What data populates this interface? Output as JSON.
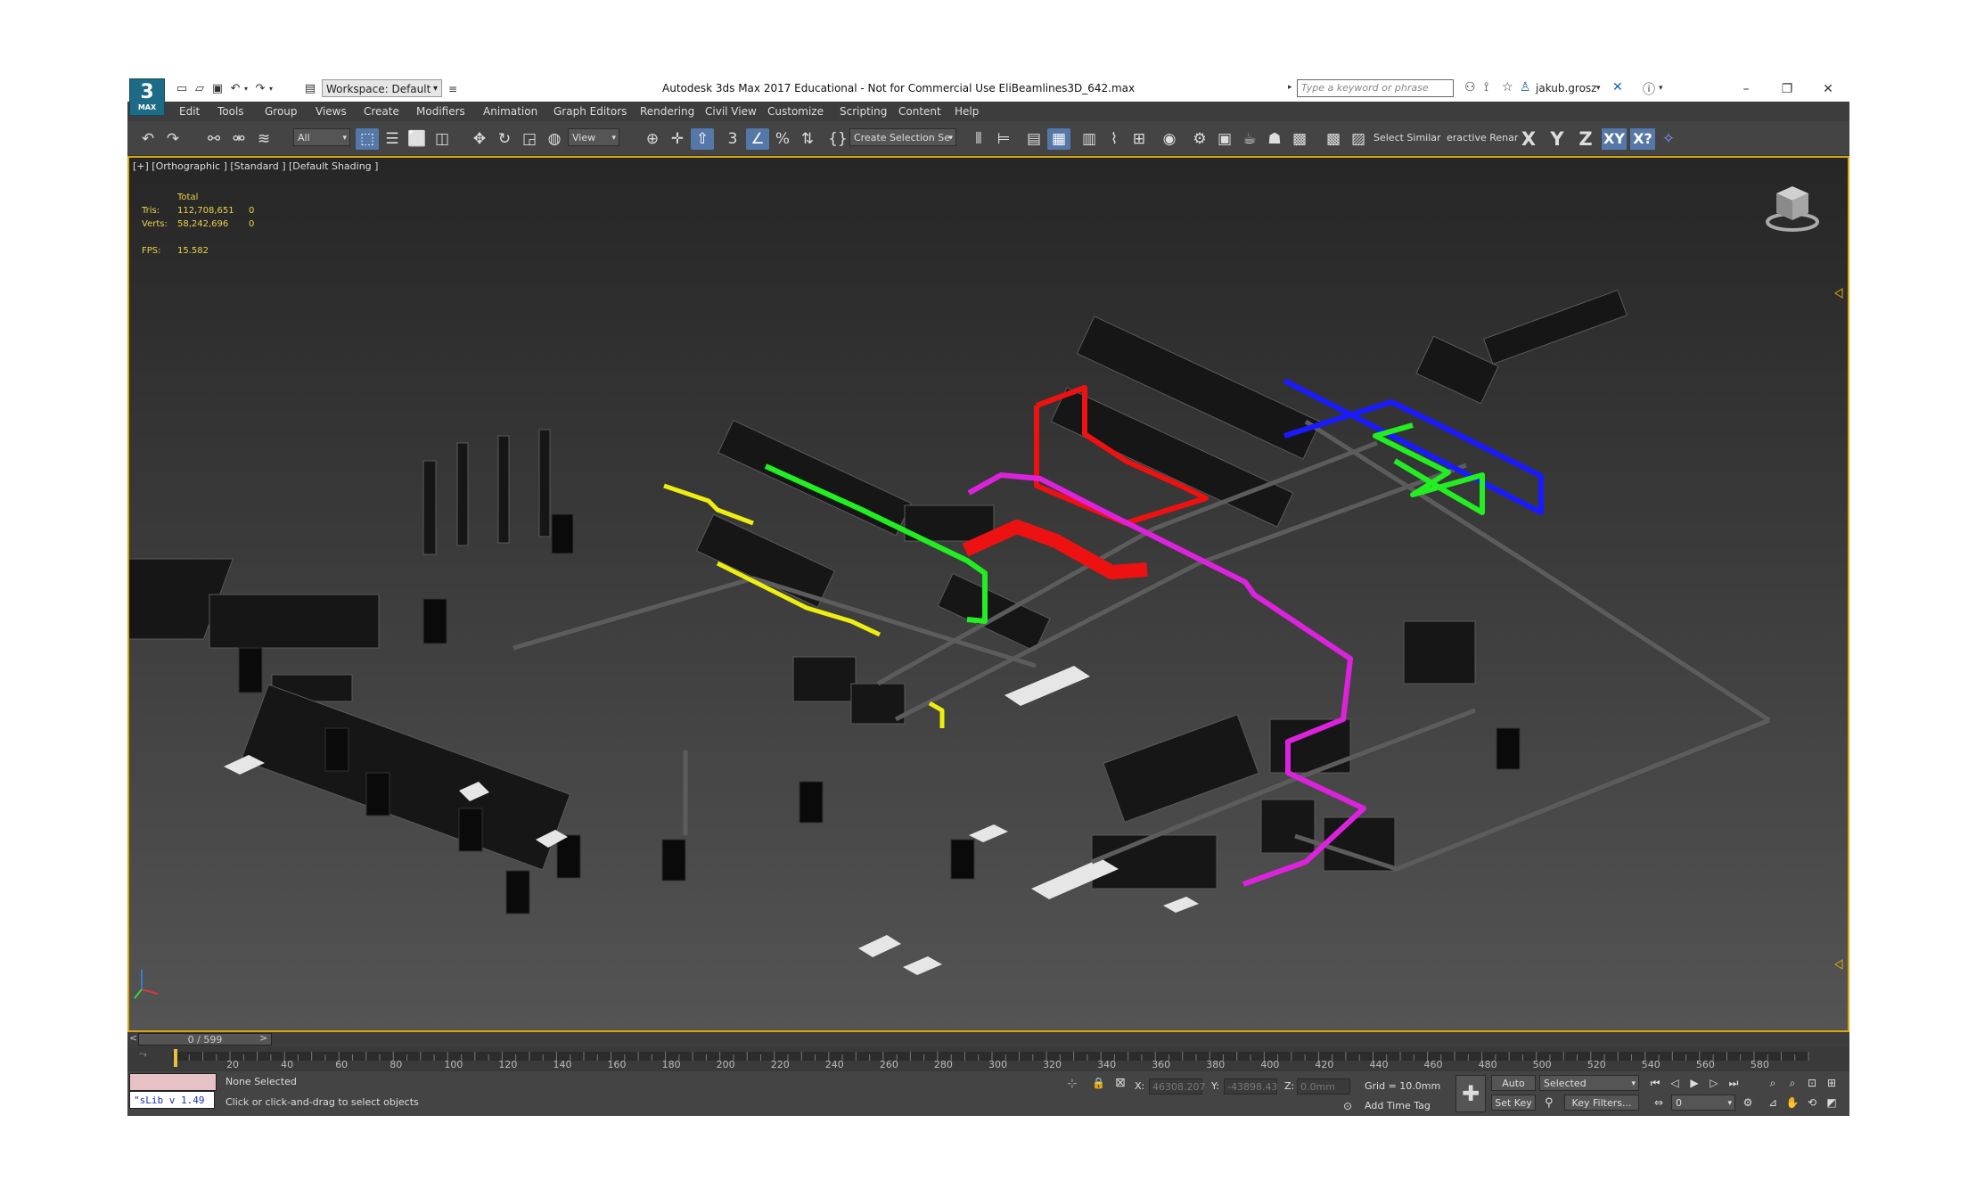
{
  "app": {
    "title": "Autodesk 3ds Max 2017 Educational - Not for Commercial Use    EliBeamlines3D_642.max",
    "logo_text": "3",
    "logo_sub": "MAX"
  },
  "titlebar": {
    "workspace": "Workspace: Default",
    "search_placeholder": "Type a keyword or phrase",
    "user": "jakub.grosz"
  },
  "menu": {
    "items": [
      "Edit",
      "Tools",
      "Group",
      "Views",
      "Create",
      "Modifiers",
      "Animation",
      "Graph Editors",
      "Rendering",
      "Civil View",
      "Customize",
      "Scripting",
      "Content",
      "Help"
    ]
  },
  "toolbar": {
    "selection_filter": "All",
    "ref_coord": "View",
    "named_selection": "Create Selection Se",
    "select_similar": "Select Similar",
    "interactive_rename": "eractive Renar",
    "axis_x": "X",
    "axis_y": "Y",
    "axis_z": "Z",
    "axis_xy": "XY",
    "axis_xy2": "X?"
  },
  "viewport": {
    "label": "[+] [Orthographic ] [Standard ] [Default Shading ]",
    "stats": {
      "header": "Total",
      "tris_label": "Tris:",
      "tris_value": "112,708,651",
      "tris_sel": "0",
      "verts_label": "Verts:",
      "verts_value": "58,242,696",
      "verts_sel": "0",
      "fps_label": "FPS:",
      "fps_value": "15.582"
    },
    "pipe_colors": {
      "blue": "#1a1aff",
      "green": "#22ee22",
      "red": "#ee1111",
      "magenta": "#dd22dd",
      "yellow": "#eeee11"
    }
  },
  "timeslider": {
    "position": "0 / 599"
  },
  "trackbar": {
    "ticks": [
      "20",
      "40",
      "60",
      "80",
      "100",
      "120",
      "140",
      "160",
      "180",
      "200",
      "220",
      "240",
      "260",
      "280",
      "300",
      "320",
      "340",
      "360",
      "380",
      "400",
      "420",
      "440",
      "460",
      "480",
      "500",
      "520",
      "540",
      "560",
      "580"
    ]
  },
  "status": {
    "selection": "None Selected",
    "prompt": "Click or click-and-drag to select objects",
    "maxscript": "\"sLib v 1.49",
    "x_label": "X:",
    "x_value": "46308.207",
    "y_label": "Y:",
    "y_value": "-43898.43",
    "z_label": "Z:",
    "z_value": "0.0mm",
    "grid": "Grid = 10.0mm",
    "add_time_tag": "Add Time Tag",
    "auto_key": "Auto Key",
    "set_key": "Set Key",
    "key_mode": "Selected",
    "key_filters": "Key Filters...",
    "frame": "0"
  }
}
